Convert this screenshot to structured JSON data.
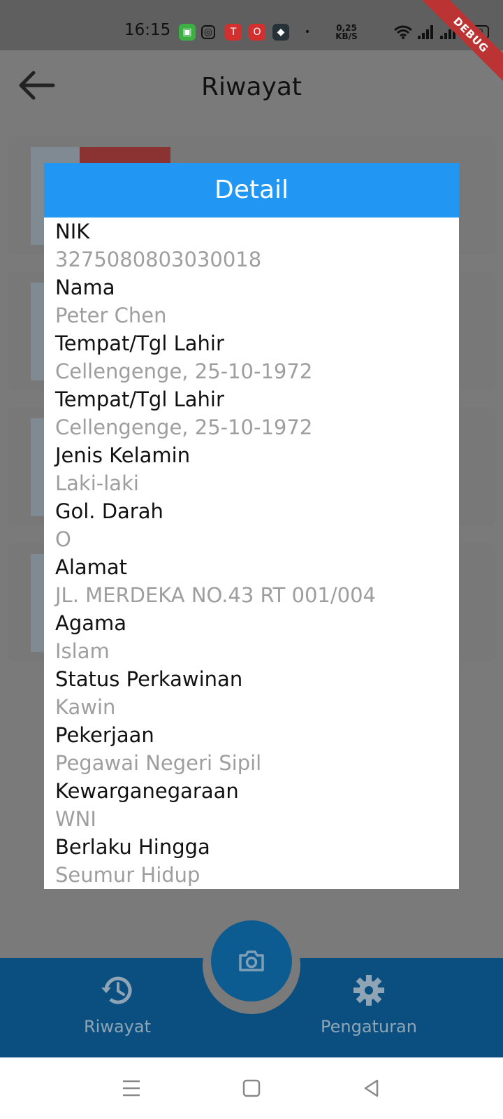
{
  "status_bar": {
    "time": "16:15",
    "speed_value": "0,25",
    "speed_unit": "KB/S",
    "battery": "100"
  },
  "debug_banner": "DEBUG",
  "app_bar": {
    "title": "Riwayat"
  },
  "dialog": {
    "title": "Detail",
    "fields": [
      {
        "label": "NIK",
        "value": "3275080803030018"
      },
      {
        "label": "Nama",
        "value": "Peter Chen"
      },
      {
        "label": "Tempat/Tgl Lahir",
        "value": "Cellengenge, 25-10-1972"
      },
      {
        "label": "Tempat/Tgl Lahir",
        "value": "Cellengenge, 25-10-1972"
      },
      {
        "label": "Jenis Kelamin",
        "value": "Laki-laki"
      },
      {
        "label": "Gol. Darah",
        "value": "O"
      },
      {
        "label": "Alamat",
        "value": "JL. MERDEKA NO.43 RT 001/004"
      },
      {
        "label": "Agama",
        "value": "Islam"
      },
      {
        "label": "Status Perkawinan",
        "value": "Kawin"
      },
      {
        "label": "Pekerjaan",
        "value": "Pegawai Negeri Sipil"
      },
      {
        "label": "Kewarganegaraan",
        "value": "WNI"
      },
      {
        "label": "Berlaku Hingga",
        "value": "Seumur Hidup"
      }
    ]
  },
  "bottom_nav": {
    "items": [
      {
        "label": "Riwayat",
        "icon": "history-icon"
      },
      {
        "label": "Pengaturan",
        "icon": "gear-icon"
      }
    ],
    "fab_icon": "camera-icon"
  },
  "colors": {
    "dialog_header": "#2196f3",
    "bottom_nav": "#0a4f7f",
    "scrim_background": "#7a7a7a"
  }
}
